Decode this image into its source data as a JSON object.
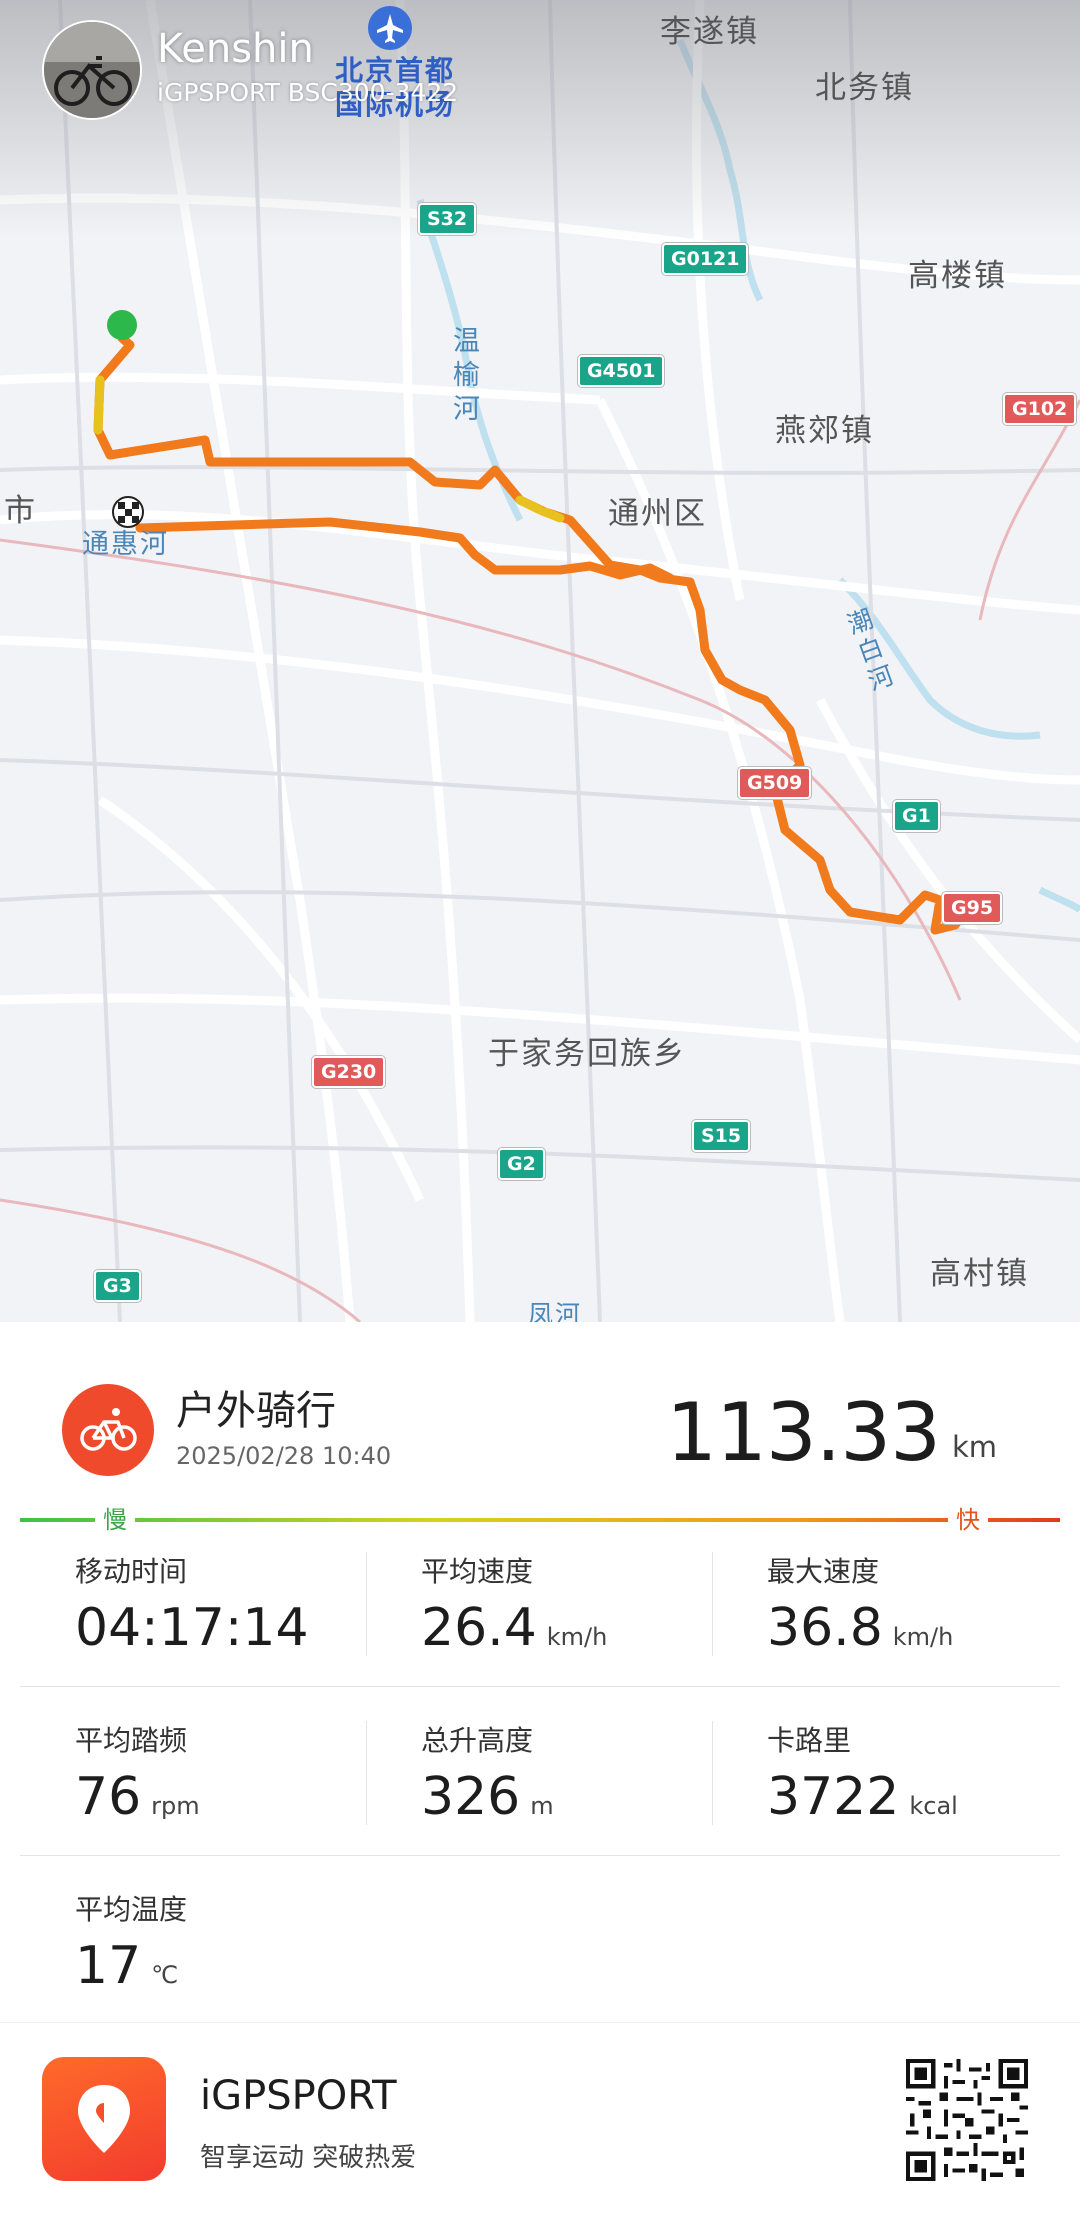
{
  "user": {
    "name": "Kenshin",
    "device": "iGPSPORT BSC300-3422"
  },
  "map": {
    "places": {
      "airport": "北京首都国际机场",
      "lisui": "李遂镇",
      "beiwu": "北务镇",
      "gaolou": "高楼镇",
      "yanjiao": "燕郊镇",
      "tongzhou": "通州区",
      "shi": "市",
      "tonghui": "通惠河",
      "wenyu": "温榆河",
      "chaobai": "潮白河",
      "yujiawu": "于家务回族乡",
      "gaocun": "高村镇",
      "fenghe": "凤河"
    },
    "roads": {
      "s32": "S32",
      "g0121": "G0121",
      "g4501": "G4501",
      "g102": "G102",
      "g509": "G509",
      "g1": "G1",
      "g95": "G95",
      "g230": "G230",
      "s15": "S15",
      "g2": "G2",
      "g3": "G3"
    }
  },
  "activity": {
    "type": "户外骑行",
    "datetime": "2025/02/28 10:40",
    "distance": "113.33",
    "distance_unit": "km",
    "speed_scale": {
      "slow": "慢",
      "fast": "快"
    }
  },
  "stats": [
    {
      "label": "移动时间",
      "value": "04:17:14",
      "unit": ""
    },
    {
      "label": "平均速度",
      "value": "26.4",
      "unit": "km/h"
    },
    {
      "label": "最大速度",
      "value": "36.8",
      "unit": "km/h"
    },
    {
      "label": "平均踏频",
      "value": "76",
      "unit": "rpm"
    },
    {
      "label": "总升高度",
      "value": "326",
      "unit": "m"
    },
    {
      "label": "卡路里",
      "value": "3722",
      "unit": "kcal"
    },
    {
      "label": "平均温度",
      "value": "17",
      "unit": "℃"
    }
  ],
  "footer": {
    "app_name": "iGPSPORT",
    "slogan": "智享运动 突破热爱"
  },
  "colors": {
    "brand": "#f04a2c",
    "route": "#f07a1c",
    "start": "#2db84b",
    "slow": "#3aa64a",
    "fast": "#e2541f"
  },
  "icons": {
    "sport": "bicycle-icon",
    "airport": "airplane-icon",
    "start": "start-marker-icon",
    "finish": "finish-flag-icon",
    "app": "location-pin-icon",
    "qr": "qr-code-icon"
  }
}
